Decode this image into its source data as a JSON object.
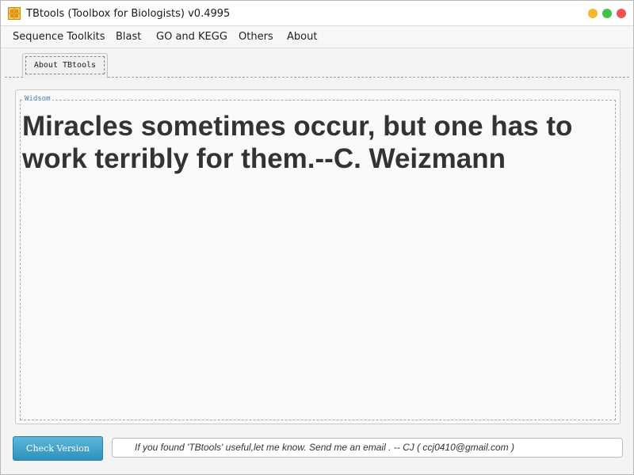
{
  "window": {
    "title": "TBtools (Toolbox for Biologists) v0.4995",
    "controls": {
      "minimize_color": "#f5b82e",
      "maximize_color": "#3ec34b",
      "close_color": "#f0524f"
    }
  },
  "menubar": {
    "items": [
      {
        "label": "Sequence Toolkits"
      },
      {
        "label": "Blast"
      },
      {
        "label": "GO and KEGG"
      },
      {
        "label": "Others"
      },
      {
        "label": "About"
      }
    ]
  },
  "tabs": [
    {
      "label": "About TBtools",
      "selected": true
    }
  ],
  "panel": {
    "legend": "Widsom",
    "quote": "Miracles sometimes occur, but one has to work terribly for them.--C. Weizmann"
  },
  "footer": {
    "check_button_label": "Check Version",
    "message": "If you found 'TBtools' useful,let me know. Send me an email . -- CJ   ( ccj0410@gmail.com )"
  },
  "colors": {
    "accent_button": "#3aa3cf",
    "legend_text": "#3d7fb8"
  }
}
